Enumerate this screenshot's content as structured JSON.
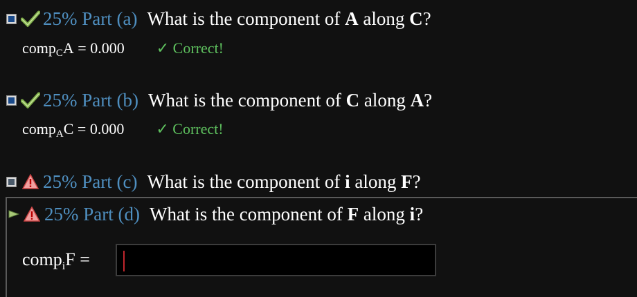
{
  "parts": [
    {
      "percent": "25%",
      "part_label": "Part (a)",
      "q_pre": "What is the component of",
      "q_b1": "A",
      "q_mid": "along",
      "q_b2": "C",
      "q_end": "?",
      "answer_prefix": "comp",
      "answer_sub": "C",
      "answer_var": "A",
      "answer_eq": "= 0.000",
      "feedback": "✓ Correct!",
      "status_icon": "check-icon"
    },
    {
      "percent": "25%",
      "part_label": "Part (b)",
      "q_pre": "What is the component of",
      "q_b1": "C",
      "q_mid": "along",
      "q_b2": "A",
      "q_end": "?",
      "answer_prefix": "comp",
      "answer_sub": "A",
      "answer_var": "C",
      "answer_eq": "= 0.000",
      "feedback": "✓ Correct!",
      "status_icon": "check-icon"
    },
    {
      "percent": "25%",
      "part_label": "Part (c)",
      "q_pre": "What is the component of",
      "q_b1": "i",
      "q_mid": "along",
      "q_b2": "F",
      "q_end": "?",
      "status_icon": "warning-icon"
    },
    {
      "percent": "25%",
      "part_label": "Part (d)",
      "q_pre": "What is the component of",
      "q_b1": "F",
      "q_mid": "along",
      "q_b2": "i",
      "q_end": "?",
      "status_icon": "warning-icon",
      "input_prefix": "comp",
      "input_sub": "i",
      "input_var": "F",
      "input_eq": "=",
      "input_value": ""
    }
  ],
  "colors": {
    "percent": "#4f8fc0",
    "correct": "#5ec05e",
    "background": "#111111"
  }
}
